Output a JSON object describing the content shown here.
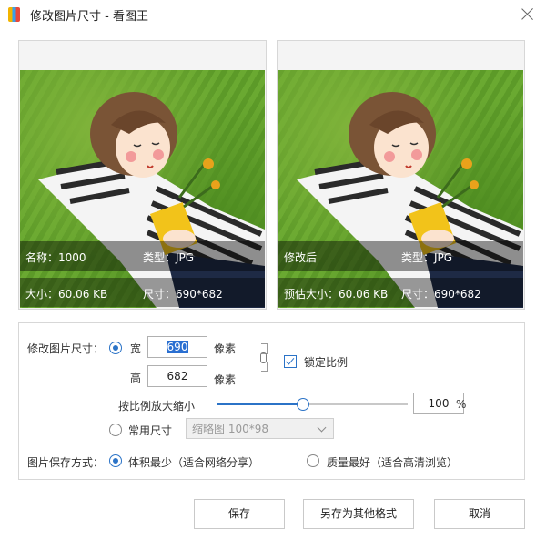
{
  "window": {
    "title": "修改图片尺寸 - 看图王"
  },
  "icons": {
    "app": "app-icon",
    "close": "close-icon",
    "link": "chain-link-icon",
    "dropdown": "chevron-down-icon"
  },
  "preview_left": {
    "name": "名称：1000",
    "type": "类型：JPG",
    "size": "大小：60.06 KB",
    "dims": "尺寸：690*682"
  },
  "preview_right": {
    "label": "修改后",
    "type": "类型：JPG",
    "est_size": "预估大小：60.06 KB",
    "dims": "尺寸：690*682"
  },
  "settings": {
    "resize_label": "修改图片尺寸：",
    "width_label": "宽",
    "width_value": "690",
    "height_label": "高",
    "height_value": "682",
    "unit": "像素",
    "lock_ratio": "锁定比例",
    "scale_label": "按比例放大缩小",
    "scale_value": "100",
    "scale_percent_fraction": 0.45,
    "percent_sign": "%",
    "common_size_label": "常用尺寸",
    "common_size_selected": "缩略图 100*98",
    "save_mode_label": "图片保存方式：",
    "option_small": "体积最少（适合网络分享）",
    "option_quality": "质量最好（适合高清浏览）"
  },
  "buttons": {
    "save": "保存",
    "save_as": "另存为其他格式",
    "cancel": "取消"
  },
  "colors": {
    "accent": "#2b73c7"
  }
}
